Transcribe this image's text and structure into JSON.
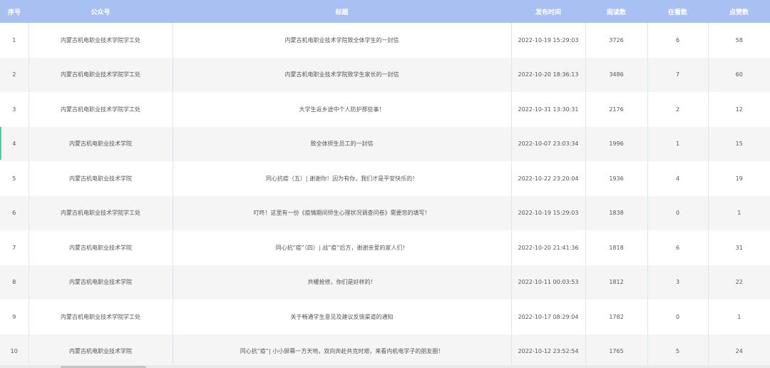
{
  "table": {
    "headers": {
      "index": "序号",
      "account": "公众号",
      "title": "标题",
      "publish_time": "发布时间",
      "reads": "阅读数",
      "watching": "在看数",
      "likes": "点赞数"
    },
    "rows": [
      {
        "index": "1",
        "account": "内蒙古机电职业技术学院学工处",
        "title": "内蒙古机电职业技术学院致全体学生的一封信",
        "publish_time": "2022-10-19 15:29:03",
        "reads": "3726",
        "watching": "6",
        "likes": "58"
      },
      {
        "index": "2",
        "account": "内蒙古机电职业技术学院学工处",
        "title": "内蒙古机电职业技术学院致学生家长的一封信",
        "publish_time": "2022-10-20 18:36:13",
        "reads": "3486",
        "watching": "7",
        "likes": "60"
      },
      {
        "index": "3",
        "account": "内蒙古机电职业技术学院学工处",
        "title": "大学生返乡途中个人防护那些事！",
        "publish_time": "2022-10-31 13:30:31",
        "reads": "2176",
        "watching": "2",
        "likes": "12"
      },
      {
        "index": "4",
        "account": "内蒙古机电职业技术学院",
        "title": "致全体师生员工的一封信",
        "publish_time": "2022-10-07 23:03:34",
        "reads": "1996",
        "watching": "1",
        "likes": "15"
      },
      {
        "index": "5",
        "account": "内蒙古机电职业技术学院",
        "title": "同心抗疫（五）| 谢谢你！因为有你，我们才是平安快乐的！",
        "publish_time": "2022-10-22 23:20:04",
        "reads": "1936",
        "watching": "4",
        "likes": "19"
      },
      {
        "index": "6",
        "account": "内蒙古机电职业技术学院学工处",
        "title": "叮咚！这里有一份《疫情期间师生心理状况调查问卷》需要您的填写！",
        "publish_time": "2022-10-19 15:29:03",
        "reads": "1838",
        "watching": "0",
        "likes": "1"
      },
      {
        "index": "7",
        "account": "内蒙古机电职业技术学院",
        "title": "同心抗“疫”（四）| 战“疫”后方，谢谢亲爱的家人们！",
        "publish_time": "2022-10-20 21:41:36",
        "reads": "1818",
        "watching": "6",
        "likes": "31"
      },
      {
        "index": "8",
        "account": "内蒙古机电职业技术学院",
        "title": "共暖抢修，你们是好样的！",
        "publish_time": "2022-10-11 00:03:53",
        "reads": "1812",
        "watching": "3",
        "likes": "22"
      },
      {
        "index": "9",
        "account": "内蒙古机电职业技术学院学工处",
        "title": "关于畅通学生意见及建议反馈渠道的通知",
        "publish_time": "2022-10-17 08:29:04",
        "reads": "1782",
        "watching": "0",
        "likes": "1"
      },
      {
        "index": "10",
        "account": "内蒙古机电职业技术学院",
        "title": "同心抗“疫”| 小小屏幕一方天地，双向奔赴共克时艰，来看内机电学子的朋友圈！",
        "publish_time": "2022-10-12 23:52:54",
        "reads": "1765",
        "watching": "5",
        "likes": "24"
      }
    ]
  },
  "colors": {
    "header_bg": "#a9c1f2",
    "header_text": "#ffffff",
    "row_alt_bg": "#f5f5f5",
    "cell_text": "#555555"
  }
}
